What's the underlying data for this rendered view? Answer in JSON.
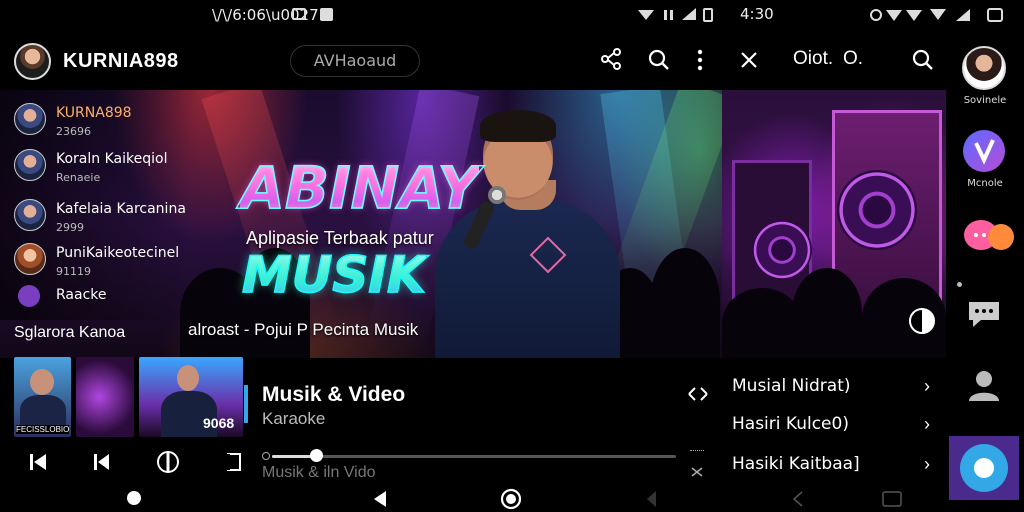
{
  "status_left": {
    "time": "\\/\\/6:06\\u0027",
    "icons": [
      "gallery-icon",
      "notification-icon"
    ]
  },
  "status_right": {
    "time": "4:30",
    "icons": [
      "vibrate-icon",
      "wifi-icon",
      "signal-icon",
      "battery-icon"
    ]
  },
  "header": {
    "username": "KURNIA898",
    "search_text": "AVHaoaud",
    "right_title": "Oiot.",
    "right_title2": "O."
  },
  "hero": {
    "headline": "ABINAY",
    "subline": "Aplipasie Terbaak patur",
    "headline2": "MUSIK",
    "tagline": "alroast - Pojui P Pecinta Musik"
  },
  "side_list": [
    {
      "name": "KURNA898",
      "sub": "23696",
      "accent": "#ff9a3c"
    },
    {
      "name": "Koraln Kaikeqiol",
      "sub": "Renaeie"
    },
    {
      "name": "Kafelaia Karcanina",
      "sub": "2999"
    },
    {
      "name": "PuniKaikeotecinel",
      "sub": "91119"
    },
    {
      "name": "Raacke",
      "sub": ""
    }
  ],
  "section_label": "Sglarora Kanoa",
  "thumb_badge": "FECISSLOBIO",
  "thumb_badge2": "9068",
  "player": {
    "title": "Musik & Video",
    "subtitle": "Karaoke",
    "progress_fraction": 0.11,
    "footer": "Musik & iln Vido"
  },
  "right_panel": {
    "rows": [
      "Musial Nidrat)",
      "Hasiri Kulce0)",
      "Hasiki Kaitbaa]"
    ]
  },
  "rail": [
    {
      "label": "Sovinele"
    },
    {
      "label": "Mcnole"
    },
    {
      "label": ""
    },
    {
      "label": ""
    },
    {
      "label": ""
    }
  ],
  "colors": {
    "accent_blue": "#33a8e6",
    "rail_bg": "#4a2a8c",
    "progress": "#dddddd"
  }
}
